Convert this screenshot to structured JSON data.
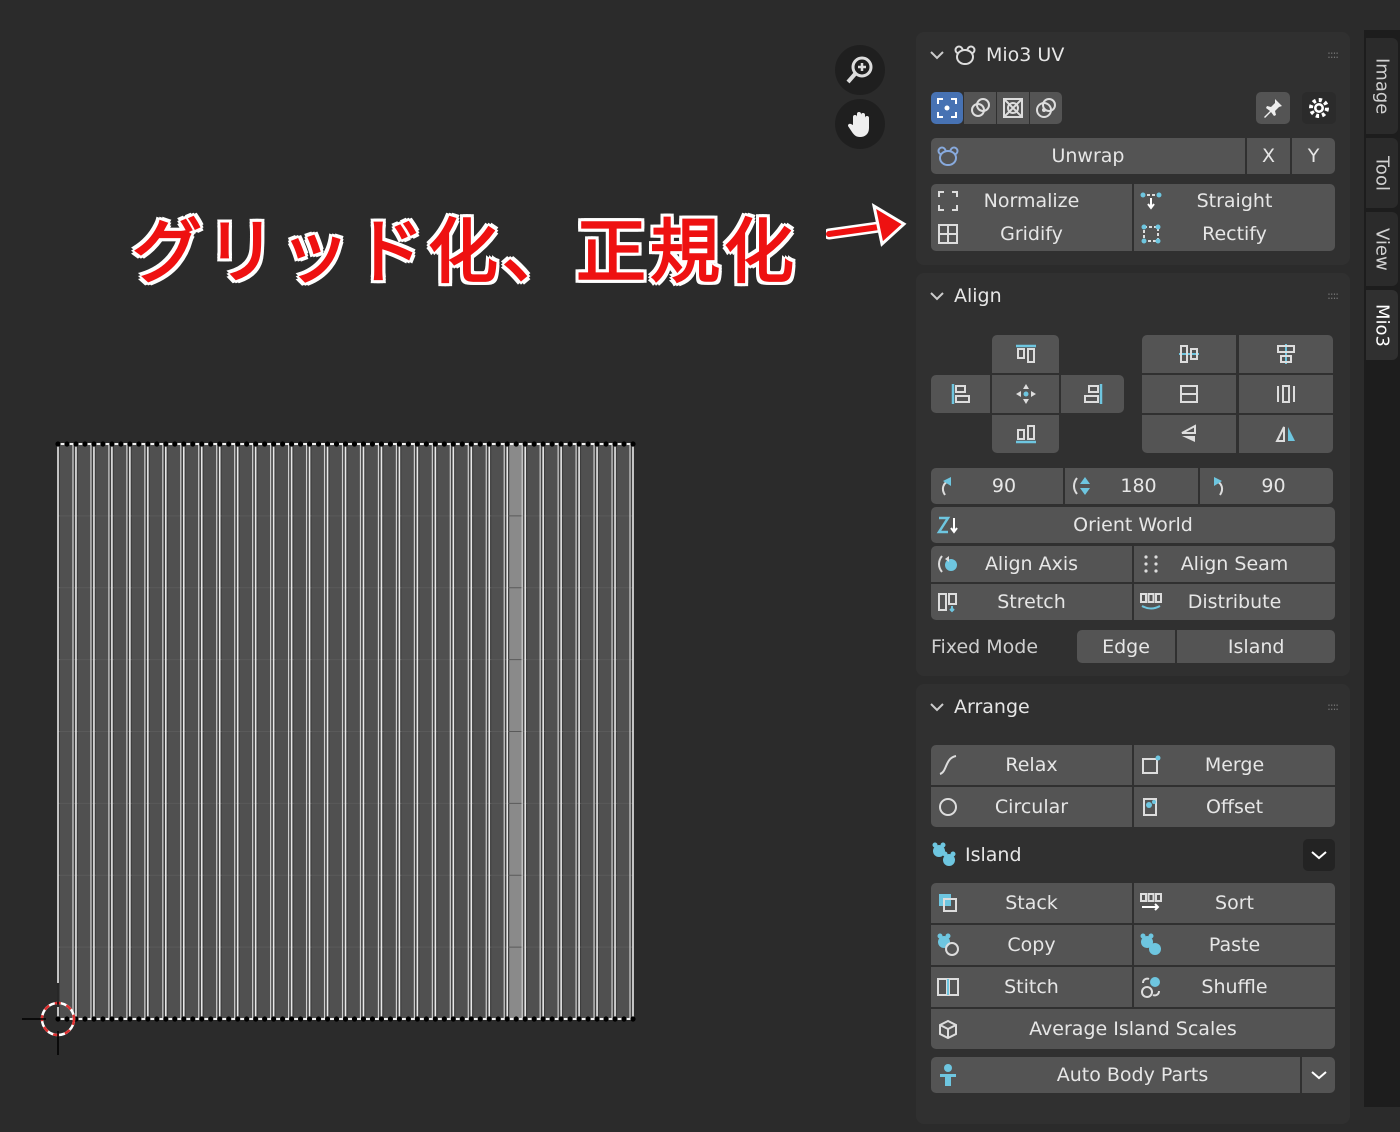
{
  "annotation": {
    "text": "グリッド化、正規化",
    "color": "#ee1111"
  },
  "viewport": {
    "nav": [
      "zoom-icon",
      "hand-pan-icon"
    ]
  },
  "sidebar_tabs": [
    "Image",
    "Tool",
    "View",
    "Mio3"
  ],
  "mio3_panel": {
    "title": "Mio3 UV",
    "unwrap": "Unwrap",
    "x": "X",
    "y": "Y",
    "normalize": "Normalize",
    "straight": "Straight",
    "gridify": "Gridify",
    "rectify": "Rectify"
  },
  "align_panel": {
    "title": "Align",
    "rot_left": "90",
    "rot_flip": "180",
    "rot_right": "90",
    "orient_world": "Orient World",
    "align_axis": "Align Axis",
    "align_seam": "Align Seam",
    "stretch": "Stretch",
    "distribute": "Distribute",
    "fixed_mode_label": "Fixed Mode",
    "edge": "Edge",
    "island": "Island"
  },
  "arrange_panel": {
    "title": "Arrange",
    "relax": "Relax",
    "merge": "Merge",
    "circular": "Circular",
    "offset": "Offset",
    "island_label": "Island",
    "stack": "Stack",
    "sort": "Sort",
    "copy": "Copy",
    "paste": "Paste",
    "stitch": "Stitch",
    "shuffle": "Shuffle",
    "average_island_scales": "Average Island Scales",
    "auto_body_parts": "Auto Body Parts"
  },
  "colors": {
    "accent_blue": "#4772b3",
    "icon_cyan": "#6ec6e0",
    "button": "#545454",
    "panel": "#303030"
  }
}
